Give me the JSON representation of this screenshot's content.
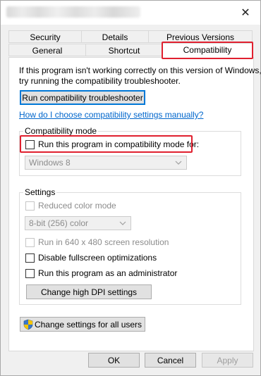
{
  "window": {
    "close_symbol": "✕"
  },
  "tabs": {
    "row1": [
      "Security",
      "Details",
      "Previous Versions"
    ],
    "row2": [
      "General",
      "Shortcut",
      "Compatibility"
    ]
  },
  "intro": {
    "line1": "If this program isn't working correctly on this version of Windows,",
    "line2": "try running the compatibility troubleshooter."
  },
  "troubleshooter_button": "Run compatibility troubleshooter",
  "manual_link": "How do I choose compatibility settings manually?",
  "compat_mode": {
    "group_label": "Compatibility mode",
    "checkbox_label": "Run this program in compatibility mode for:",
    "select_value": "Windows 8"
  },
  "settings": {
    "group_label": "Settings",
    "reduced_color_label": "Reduced color mode",
    "color_select_value": "8-bit (256) color",
    "run_640_label": "Run in 640 x 480 screen resolution",
    "disable_fullscreen_label": "Disable fullscreen optimizations",
    "run_admin_label": "Run this program as an administrator",
    "dpi_button": "Change high DPI settings"
  },
  "all_users_button": "Change settings for all users",
  "footer": {
    "ok": "OK",
    "cancel": "Cancel",
    "apply": "Apply"
  },
  "colors": {
    "highlight_red": "#e0202f",
    "link_blue": "#0066cc",
    "focus_blue": "#0078d7"
  }
}
